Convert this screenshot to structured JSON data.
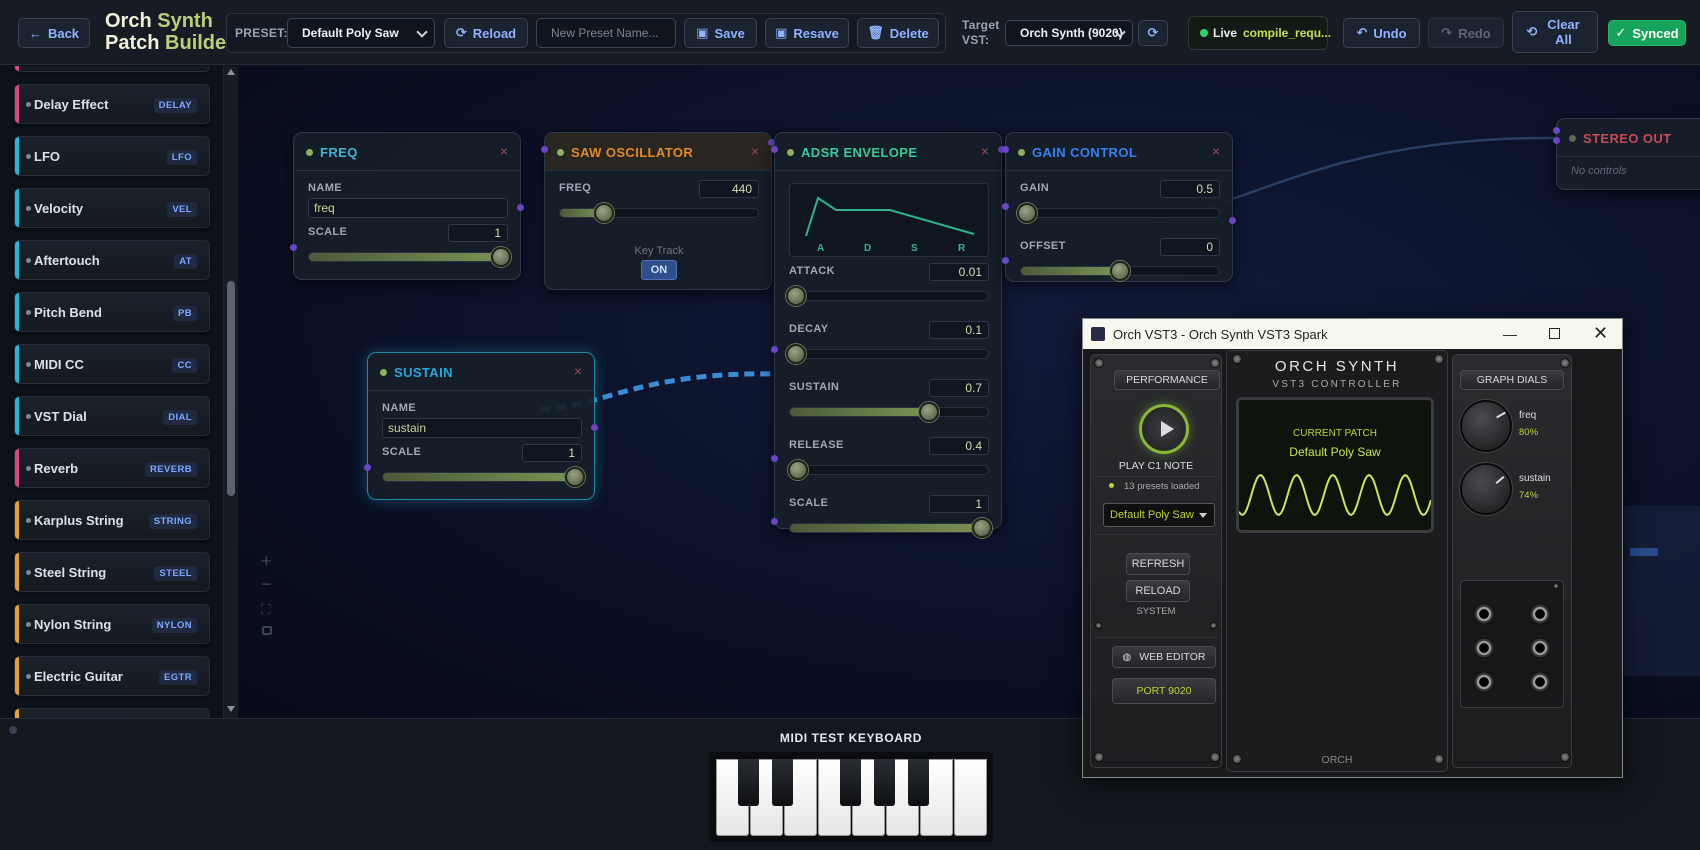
{
  "topbar": {
    "back_label": "Back",
    "brand_line1_a": "Orch ",
    "brand_line1_b": "Synth",
    "brand_line2_a": "Patch ",
    "brand_line2_b": "Builder",
    "preset_label": "PRESET:",
    "preset_value": "Default Poly Saw",
    "reload_label": "Reload",
    "preset_name_placeholder": "New Preset Name...",
    "save_label": "Save",
    "resave_label": "Resave",
    "delete_label": "Delete",
    "target_vst_label": "Target VST:",
    "target_vst_value": "Orch Synth (9020)",
    "live_label": "Live",
    "live_status": "compile_requ...",
    "undo_label": "Undo",
    "redo_label": "Redo",
    "clear_all_label": "Clear All",
    "synced_label": "Synced"
  },
  "sidebar": {
    "items": [
      {
        "name": "Delay Effect",
        "tag": "DELAY",
        "color": "#e0457a"
      },
      {
        "name": "LFO",
        "tag": "LFO",
        "color": "#22b8d8"
      },
      {
        "name": "Velocity",
        "tag": "VEL",
        "color": "#22b8d8"
      },
      {
        "name": "Aftertouch",
        "tag": "AT",
        "color": "#22b8d8"
      },
      {
        "name": "Pitch Bend",
        "tag": "PB",
        "color": "#22b8d8"
      },
      {
        "name": "MIDI CC",
        "tag": "CC",
        "color": "#22b8d8"
      },
      {
        "name": "VST Dial",
        "tag": "DIAL",
        "color": "#22b8d8"
      },
      {
        "name": "Reverb",
        "tag": "REVERB",
        "color": "#e0457a"
      },
      {
        "name": "Karplus String",
        "tag": "STRING",
        "color": "#e8a02a"
      },
      {
        "name": "Steel String",
        "tag": "STEEL",
        "color": "#e8a02a"
      },
      {
        "name": "Nylon String",
        "tag": "NYLON",
        "color": "#e8a02a"
      },
      {
        "name": "Electric Guitar",
        "tag": "EGTR",
        "color": "#e8a02a"
      }
    ]
  },
  "nodes": {
    "freq": {
      "title": "FREQ",
      "name_label": "NAME",
      "name_value": "freq",
      "scale_label": "SCALE",
      "scale_value": "1",
      "scale_level": 1.0
    },
    "saw": {
      "title": "SAW OSCILLATOR",
      "freq_label": "FREQ",
      "freq_value": "440",
      "freq_level": 0.22,
      "keytrack_label": "Key Track",
      "keytrack_value": "ON"
    },
    "adsr": {
      "title": "ADSR ENVELOPE",
      "env_labels": [
        "A",
        "D",
        "S",
        "R"
      ],
      "params": [
        {
          "label": "ATTACK",
          "value": "0.01",
          "level": 0.0
        },
        {
          "label": "DECAY",
          "value": "0.1",
          "level": 0.01
        },
        {
          "label": "SUSTAIN",
          "value": "0.7",
          "level": 0.7
        },
        {
          "label": "RELEASE",
          "value": "0.4",
          "level": 0.04
        },
        {
          "label": "SCALE",
          "value": "1",
          "level": 1.0
        }
      ]
    },
    "gain": {
      "title": "GAIN CONTROL",
      "gain_label": "GAIN",
      "gain_value": "0.5",
      "gain_level": 0.0,
      "offset_label": "OFFSET",
      "offset_value": "0",
      "offset_level": 0.5
    },
    "sustain": {
      "title": "SUSTAIN",
      "name_label": "NAME",
      "name_value": "sustain",
      "scale_label": "SCALE",
      "scale_value": "1",
      "scale_level": 1.0
    },
    "stereo": {
      "title": "STEREO OUT",
      "empty_text": "No controls"
    }
  },
  "vst_window": {
    "title": "Orch VST3 - Orch Synth VST3 Spark",
    "performance_label": "PERFORMANCE",
    "play_label": "PLAY C1 NOTE",
    "presets_loaded": "13 presets loaded",
    "preset_value": "Default Poly Saw",
    "refresh_label": "REFRESH",
    "reload_label": "RELOAD",
    "system_label": "SYSTEM",
    "web_editor_label": "WEB EDITOR",
    "port_label": "PORT 9020",
    "brand_title": "ORCH SYNTH",
    "brand_subtitle": "VST3 CONTROLLER",
    "current_patch_label": "CURRENT PATCH",
    "current_patch_value": "Default Poly Saw",
    "footer_brand": "ORCH",
    "graph_dials_label": "GRAPH DIALS",
    "dials": [
      {
        "name": "freq",
        "value": "80%"
      },
      {
        "name": "sustain",
        "value": "74%"
      }
    ]
  },
  "keyboard": {
    "title": "MIDI TEST KEYBOARD"
  }
}
